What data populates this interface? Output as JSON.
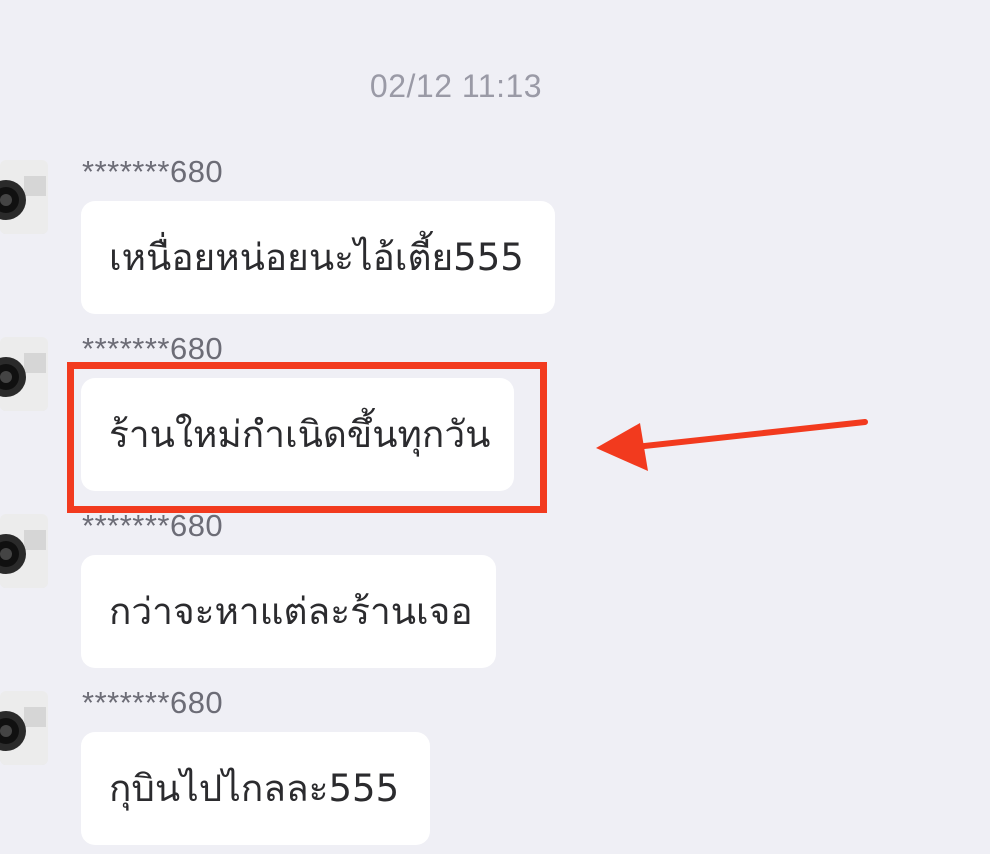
{
  "chat": {
    "timestamp": "02/12 11:13",
    "messages": [
      {
        "sender": "*******680",
        "text": "เหนื่อยหน่อยนะไอ้เตี้ย555"
      },
      {
        "sender": "*******680",
        "text": "ร้านใหม่กำเนิดขึ้นทุกวัน"
      },
      {
        "sender": "*******680",
        "text": "กว่าจะหาแต่ละร้านเจอ"
      },
      {
        "sender": "*******680",
        "text": "กุบินไปไกลละ555"
      }
    ]
  },
  "annotation": {
    "color": "#f23a1e",
    "highlighted_message_index": 1
  },
  "icons": {
    "avatar": "camera-lens-avatar",
    "arrow": "pointer-arrow-icon"
  }
}
